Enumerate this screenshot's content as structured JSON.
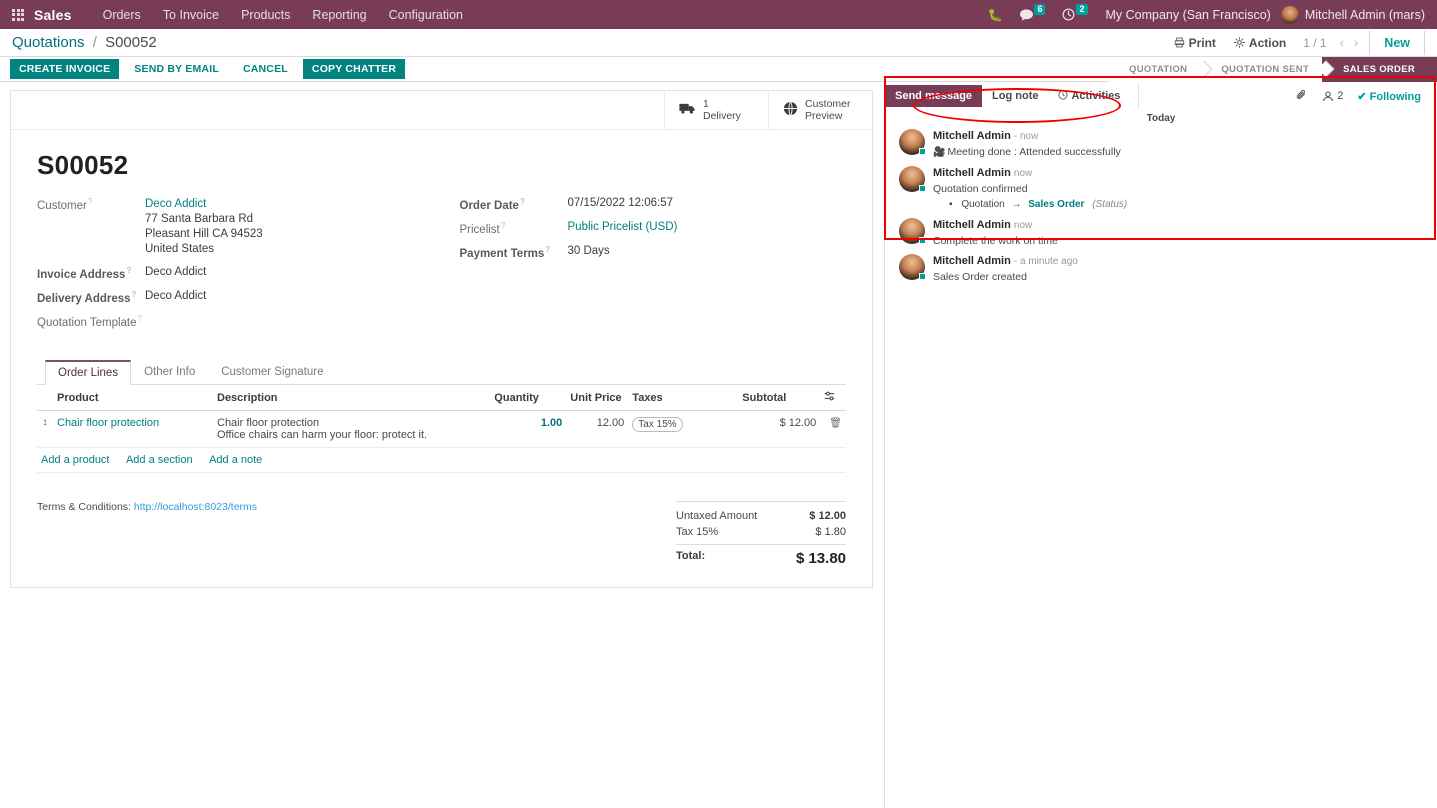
{
  "navbar": {
    "apps_icon": "grid-apps-icon",
    "brand": "Sales",
    "menus": [
      "Orders",
      "To Invoice",
      "Products",
      "Reporting",
      "Configuration"
    ],
    "debug_icon": "bug-icon",
    "messages_icon": "messages-icon",
    "messages_count": "6",
    "activities_icon": "clock-icon",
    "activities_count": "2",
    "company": "My Company (San Francisco)",
    "user": "Mitchell Admin (mars)"
  },
  "control_panel": {
    "breadcrumb_root": "Quotations",
    "breadcrumb_sep": "/",
    "breadcrumb_current": "S00052",
    "print_label": "Print",
    "print_icon": "printer-icon",
    "action_label": "Action",
    "action_icon": "gear-icon",
    "pager": "1 / 1",
    "prev_icon": "chevron-left-icon",
    "next_icon": "chevron-right-icon",
    "new_label": "New"
  },
  "action_buttons": [
    {
      "label": "CREATE INVOICE",
      "style": "primary"
    },
    {
      "label": "SEND BY EMAIL",
      "style": "link"
    },
    {
      "label": "CANCEL",
      "style": "link"
    },
    {
      "label": "COPY CHATTER",
      "style": "primary"
    }
  ],
  "statusbar": {
    "stages": [
      "QUOTATION",
      "QUOTATION SENT",
      "SALES ORDER"
    ],
    "active": "SALES ORDER"
  },
  "smart_buttons": [
    {
      "icon": "truck-icon",
      "count": "1",
      "label": "Delivery"
    },
    {
      "icon": "globe-icon",
      "count": "Customer",
      "label": "Preview"
    }
  ],
  "record": {
    "title": "S00052",
    "left_fields": [
      {
        "label": "Customer",
        "required_mark": "?"
      },
      {
        "label": "Invoice Address",
        "required_mark": "?"
      },
      {
        "label": "Delivery Address",
        "required_mark": "?"
      },
      {
        "label": "Quotation Template",
        "required_mark": "?"
      }
    ],
    "customer_name": "Deco Addict",
    "customer_street": "77 Santa Barbara Rd",
    "customer_city": "Pleasant Hill CA 94523",
    "customer_country": "United States",
    "invoice_address": "Deco Addict",
    "delivery_address": "Deco Addict",
    "quotation_template": "",
    "right_fields": [
      {
        "label": "Order Date",
        "value": "07/15/2022 12:06:57",
        "required_mark": "?"
      },
      {
        "label": "Pricelist",
        "value": "Public Pricelist (USD)",
        "required_mark": "?"
      },
      {
        "label": "Payment Terms",
        "value": "30 Days",
        "required_mark": "?"
      }
    ]
  },
  "notebook": {
    "tabs": [
      "Order Lines",
      "Other Info",
      "Customer Signature"
    ],
    "active_tab": "Order Lines"
  },
  "lines_table": {
    "headers": [
      "Product",
      "Description",
      "Quantity",
      "Unit Price",
      "Taxes",
      "Subtotal"
    ],
    "options_icon": "column-options-icon",
    "rows": [
      {
        "handle_icon": "drag-handle-icon",
        "product": "Chair floor protection",
        "description": "Chair floor protection",
        "description_note": "Office chairs can harm your floor: protect it.",
        "quantity": "1.00",
        "unit_price": "12.00",
        "tax": "Tax 15%",
        "subtotal": "$ 12.00",
        "delete_icon": "trash-icon"
      }
    ],
    "add_links": [
      "Add a product",
      "Add a section",
      "Add a note"
    ]
  },
  "footer": {
    "terms_label": "Terms & Conditions:",
    "terms_url": "http://localhost:8023/terms",
    "totals": [
      {
        "label": "Untaxed Amount",
        "value": "$ 12.00"
      },
      {
        "label": "Tax 15%",
        "value": "$ 1.80"
      }
    ],
    "total_label": "Total:",
    "total_value": "$ 13.80"
  },
  "chatter": {
    "send_message": "Send message",
    "log_note": "Log note",
    "activities": "Activities",
    "activities_icon": "clock-icon",
    "attachment_icon": "paperclip-icon",
    "followers_icon": "followers-icon",
    "followers_count": "2",
    "following_icon": "check-icon",
    "following_label": "Following",
    "day_separator": "Today",
    "messages": [
      {
        "author": "Mitchell Admin",
        "time": "- now",
        "icon": "video-camera-icon",
        "text": "Meeting done : Attended successfully",
        "highlighted": true
      },
      {
        "author": "Mitchell Admin",
        "time": "now",
        "text": "Quotation confirmed",
        "tracking": {
          "old": "Quotation",
          "arrow": "→",
          "new": "Sales Order",
          "field": "(Status)"
        }
      },
      {
        "author": "Mitchell Admin",
        "time": "now",
        "text": "Complete the work on time"
      },
      {
        "author": "Mitchell Admin",
        "time": "- a minute ago",
        "text": "Sales Order created"
      }
    ]
  },
  "colors": {
    "navbar": "#793c57",
    "primary_teal": "#00847f",
    "link_teal": "#017e84",
    "badge_teal": "#00a09d",
    "annotation_red": "#ee0000"
  }
}
